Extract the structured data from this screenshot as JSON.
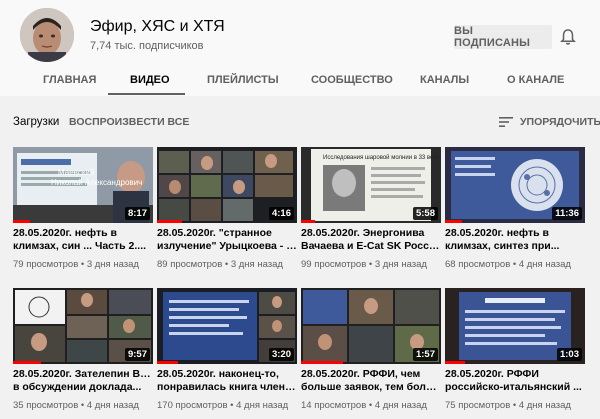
{
  "channel": {
    "name": "Эфир, ХЯС и ХТЯ",
    "subscribers": "7,74 тыс. подписчиков",
    "subscribe_label": "ВЫ ПОДПИСАНЫ",
    "bell_icon": "bell-icon"
  },
  "tabs": [
    {
      "label": "ГЛАВНАЯ"
    },
    {
      "label": "ВИДЕО"
    },
    {
      "label": "ПЛЕЙЛИСТЫ"
    },
    {
      "label": "СООБЩЕСТВО"
    },
    {
      "label": "КАНАЛЫ"
    },
    {
      "label": "О КАНАЛЕ"
    }
  ],
  "section": {
    "title": "Загрузки",
    "play_all": "ВОСПРОИЗВЕСТИ ВСЕ",
    "sort_label": "УПОРЯДОЧИТЬ"
  },
  "videos": [
    {
      "line1": "28.05.2020г. нефть в",
      "line2": "климзах, син ... Часть 2....",
      "meta": "79 просмотров • 3 дня назад",
      "duration": "8:17",
      "watched": 0.12,
      "overlay": "Маевский\nНиколай Александрович"
    },
    {
      "line1": "28.05.2020г. \"странное",
      "line2": "излучение\" Урыцкоева - эт...",
      "meta": "89 просмотров • 3 дня назад",
      "duration": "4:16",
      "watched": 0.18,
      "overlay": ""
    },
    {
      "line1": "28.05.2020г. Энергонива",
      "line2": "Вачаева и E-Cat SK Росси...",
      "meta": "99 просмотров • 3 дня назад",
      "duration": "5:58",
      "watched": 0.1,
      "overlay": "Исследования шаровой молнии в 33 веке"
    },
    {
      "line1": "28.05.2020г. нефть в",
      "line2": "климзах, синтез при...",
      "meta": "68 просмотров • 4 дня назад",
      "duration": "11:36",
      "watched": 0.12,
      "overlay": ""
    },
    {
      "line1": "28.05.2020г. Зателепин В.Н.",
      "line2": "в обсуждении доклада...",
      "meta": "35 просмотров • 4 дня назад",
      "duration": "9:57",
      "watched": 0.2,
      "overlay": ""
    },
    {
      "line1": "28.05.2020г. наконец-то,",
      "line2": "понравилась книга члена...",
      "meta": "170 просмотров • 4 дня назад",
      "duration": "3:20",
      "watched": 0.15,
      "overlay": ""
    },
    {
      "line1": "28.05.2020г. РФФИ, чем",
      "line2": "больше заявок, тем боль...",
      "meta": "14 просмотров • 4 дня назад",
      "duration": "1:57",
      "watched": 0.3,
      "overlay": ""
    },
    {
      "line1": "28.05.2020г. РФФИ",
      "line2": "российско-итальянский ...",
      "meta": "75 просмотров • 4 дня назад",
      "duration": "1:03",
      "watched": 0.14,
      "overlay": ""
    }
  ]
}
